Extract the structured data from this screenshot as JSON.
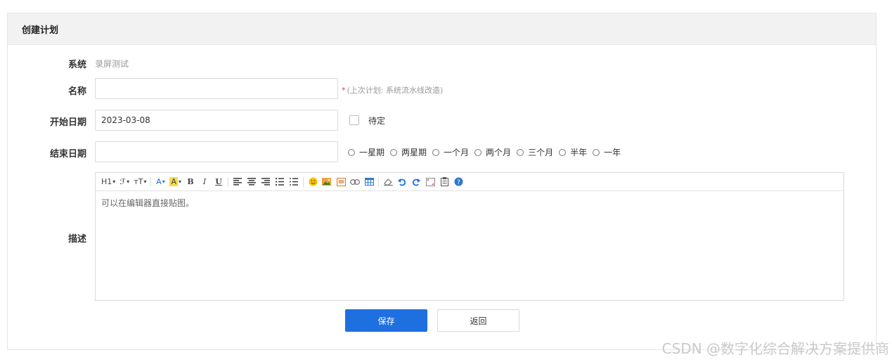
{
  "header": {
    "title": "创建计划"
  },
  "form": {
    "system": {
      "label": "系统",
      "value": "录屏测试"
    },
    "name": {
      "label": "名称",
      "value": "",
      "required_mark": "*",
      "hint": "(上次计划: 系统流水线改造)"
    },
    "start_date": {
      "label": "开始日期",
      "value": "2023-03-08",
      "pending_label": "待定",
      "pending_checked": false
    },
    "end_date": {
      "label": "结束日期",
      "value": "",
      "options": [
        "一星期",
        "两星期",
        "一个月",
        "两个月",
        "三个月",
        "半年",
        "一年"
      ]
    },
    "description": {
      "label": "描述",
      "placeholder": "可以在编辑器直接贴图。",
      "toolbar": {
        "heading": "H1",
        "font_family": "ℱ",
        "font_size": "тT",
        "font_color": "A",
        "highlight": "A",
        "bold": "B",
        "italic": "I",
        "underline": "U"
      }
    }
  },
  "buttons": {
    "save": "保存",
    "back": "返回"
  },
  "watermark": "CSDN @数字化综合解决方案提供商",
  "colors": {
    "primary": "#1e6fe0",
    "required": "#e4393c",
    "highlight": "#f7d94c"
  }
}
